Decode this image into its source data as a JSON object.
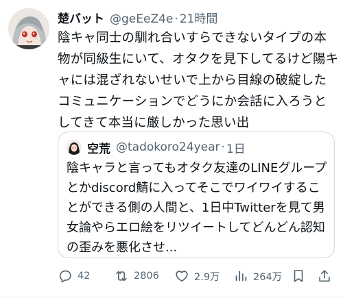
{
  "tweet": {
    "author": {
      "name": "楚バット",
      "handle": "@geEeZ4e",
      "time": "21時間"
    },
    "separator": "·",
    "text": "陰キャ同士の馴れ合いすらできないタイプの本物が同級生にいて、オタクを見下してるけど陽キャには混ざれないせいで上から目線の破綻したコミュニケーションでどうにか会話に入ろうとしてきて本当に厳しかった思い出"
  },
  "quote": {
    "author": {
      "name": "空荒",
      "handle": "@tadokoro24year",
      "time": "1日"
    },
    "text": "陰キャラと言ってもオタク友達のLINEグループとかdiscord鯖に入ってそこでワイワイすることができる側の人間と、1日中Twitterを見て男女論やらエロ絵をリツイートしてどんどん認知の歪みを悪化させ..."
  },
  "actions": {
    "reply_count": "42",
    "retweet_count": "2806",
    "like_count": "2.9万",
    "view_count": "264万"
  },
  "icons": {
    "reply": "reply-icon",
    "retweet": "retweet-icon",
    "like": "heart-icon",
    "views": "analytics-icon",
    "bookmark": "bookmark-icon",
    "share": "share-icon"
  },
  "colors": {
    "text": "#0f1419",
    "secondary": "#536471",
    "border": "#cfd9de"
  }
}
